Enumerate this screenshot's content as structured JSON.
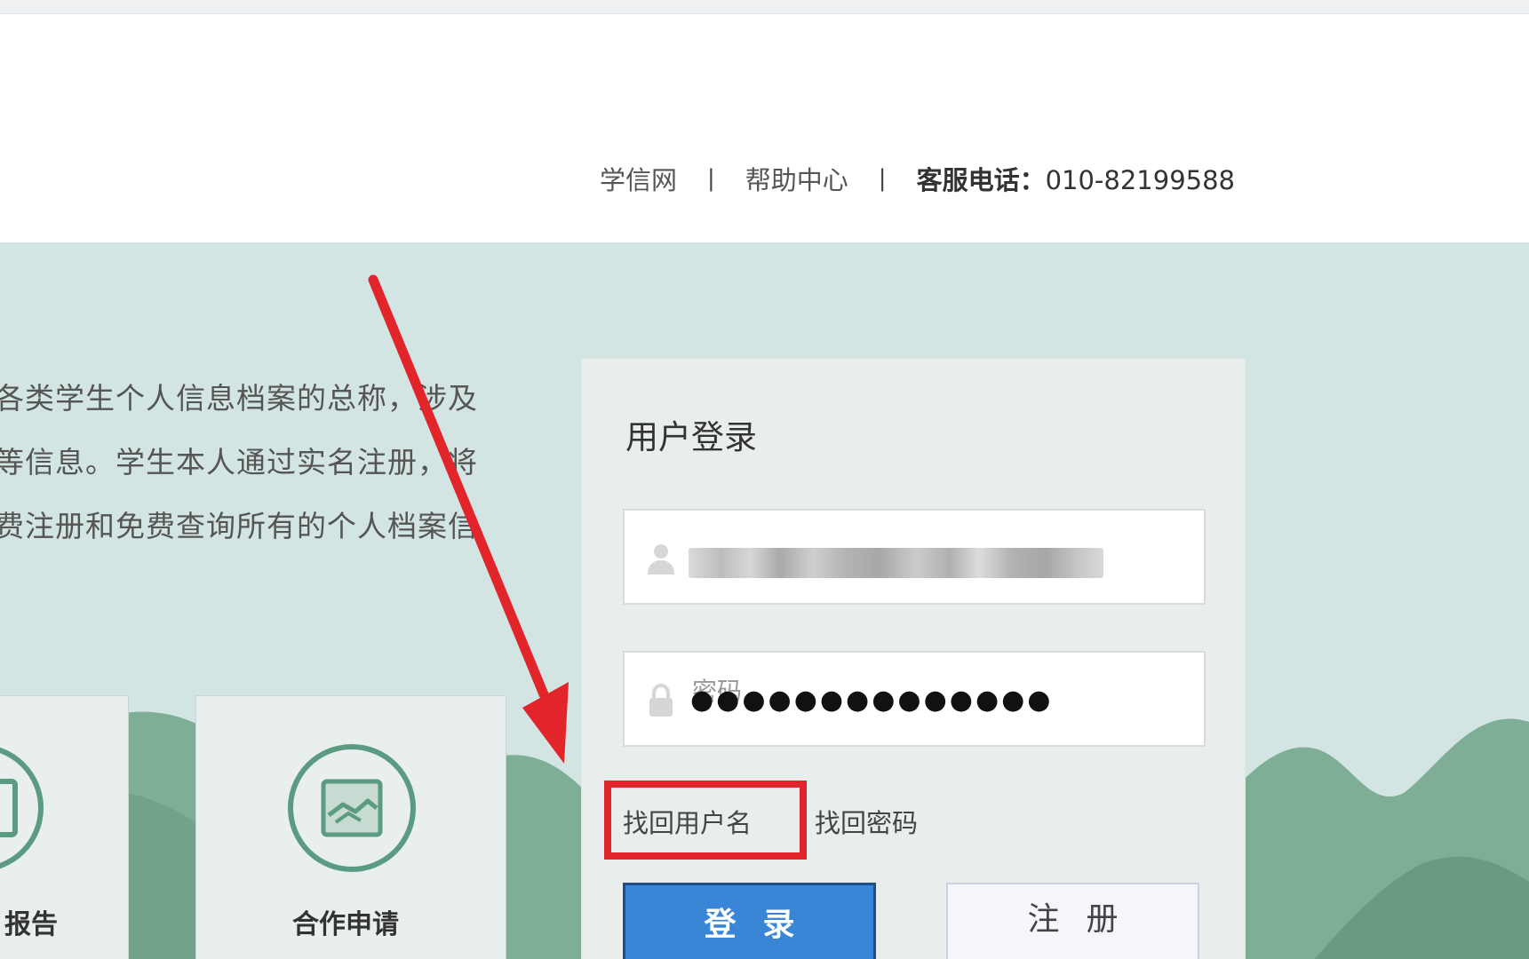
{
  "header": {
    "links": [
      {
        "label": "学信网"
      },
      {
        "label": "帮助中心"
      }
    ],
    "separator": "|",
    "hotline_label": "客服电话：",
    "hotline_number": "010-82199588"
  },
  "intro": {
    "lines": [
      "各类学生个人信息档案的总称，涉及",
      "等信息。学生本人通过实名注册，将",
      "费注册和免费查询所有的个人档案信"
    ]
  },
  "cards": [
    {
      "label": "报告"
    },
    {
      "label": "合作申请"
    }
  ],
  "login": {
    "title": "用户登录",
    "password_placeholder": "密码",
    "password_mask": "●●●●●●●●●●●●●●",
    "forgot_username": "找回用户名",
    "forgot_password": "找回密码",
    "login_button": "登录",
    "register_button": "注册"
  },
  "colors": {
    "accent_blue": "#3a86d6",
    "highlight_red": "#e2252b",
    "panel_bg": "#d3e5e2",
    "hill_green": "#7fae96"
  }
}
